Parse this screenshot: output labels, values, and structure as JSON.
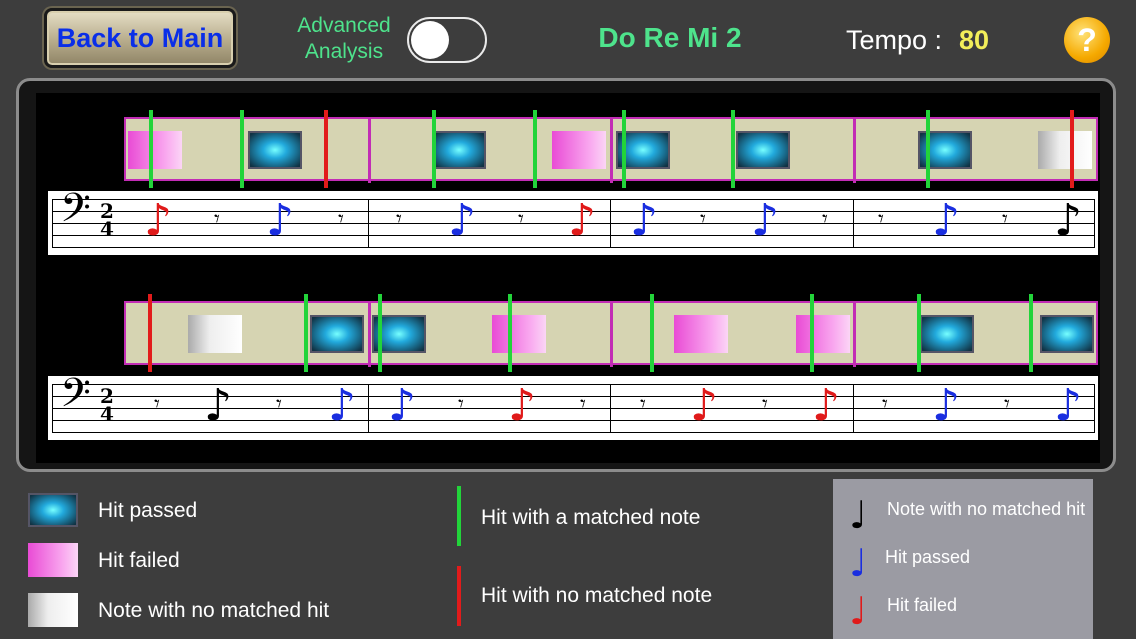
{
  "header": {
    "back_label": "Back to Main",
    "advanced_label_line1": "Advanced",
    "advanced_label_line2": "Analysis",
    "advanced_enabled": false,
    "song_title": "Do Re Mi 2",
    "tempo_label": "Tempo :",
    "tempo_value": "80",
    "help_label": "?"
  },
  "score": {
    "time_signature_top": "2",
    "time_signature_bottom": "4",
    "clef": "bass"
  },
  "legend": {
    "hit_passed": "Hit passed",
    "hit_failed": "Hit failed",
    "note_no_match": "Note with no matched hit",
    "hit_matched_note": "Hit with a matched note",
    "hit_no_matched_note": "Hit with no matched note",
    "right_note_no_match": "Note with no matched hit",
    "right_hit_passed": "Hit passed",
    "right_hit_failed": "Hit failed"
  },
  "colors": {
    "accent_green": "#4ee38c",
    "tempo_yellow": "#f2ee5a",
    "back_text": "#0a2ee8",
    "matched_line": "#22d43a",
    "unmatched_line": "#e21b1b",
    "note_passed": "#1a2ee0",
    "note_failed": "#e01a1a",
    "note_unmatched": "#000000"
  },
  "icons": {
    "help": "question-mark-icon",
    "clef": "bass-clef-icon"
  }
}
